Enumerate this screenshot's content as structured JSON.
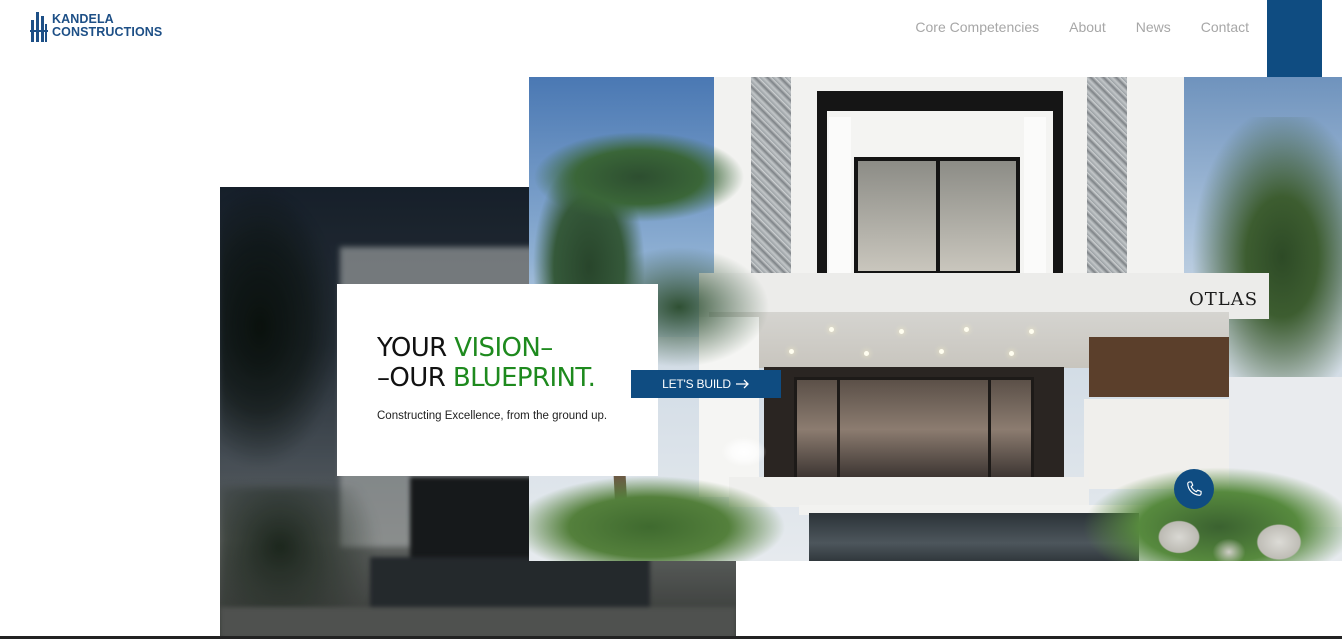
{
  "brand": {
    "line1": "KANDELA",
    "line2": "CONSTRUCTIONS",
    "color": "#1d4f86"
  },
  "nav": {
    "items": [
      {
        "label": "Core Competencies"
      },
      {
        "label": "About"
      },
      {
        "label": "News"
      },
      {
        "label": "Contact"
      }
    ]
  },
  "hero": {
    "title_part1": "YOUR ",
    "title_part1_accent": "VISION–",
    "title_part2": "–OUR ",
    "title_part2_accent": "BLUEPRINT.",
    "subtitle": "Constructing Excellence, from the ground up.",
    "cta_label": "LET'S BUILD",
    "cta_icon": "arrow-right-icon",
    "house_sign": "OTLAS"
  },
  "floating": {
    "phone_icon": "phone-icon"
  },
  "colors": {
    "primary": "#0f4c81",
    "accent_green": "#1e8a1e",
    "nav_text": "#a7a7a7"
  }
}
